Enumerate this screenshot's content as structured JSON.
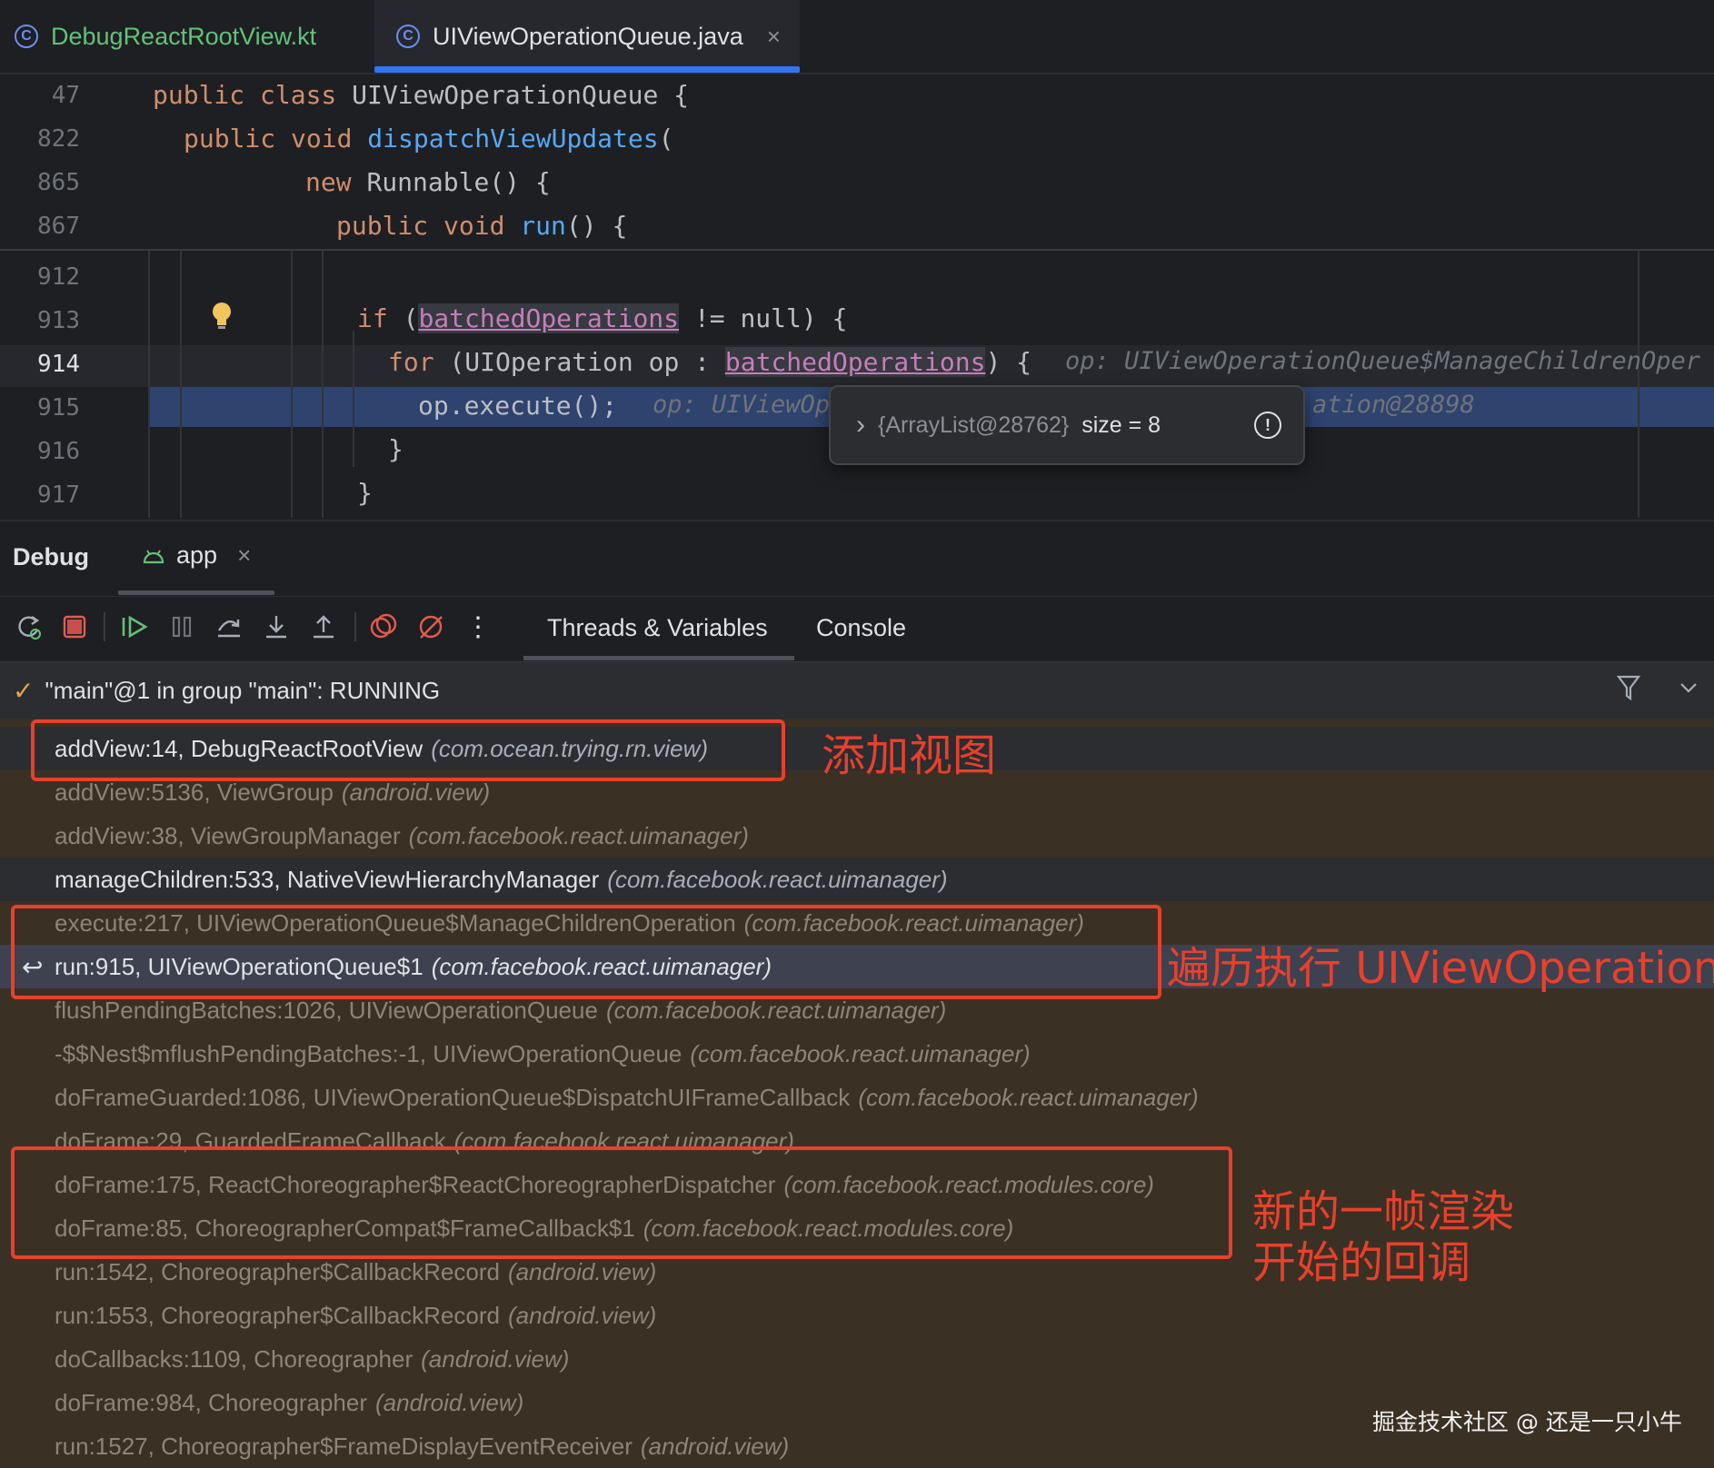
{
  "tabs": [
    {
      "label": "DebugReactRootView.kt"
    },
    {
      "label": "UIViewOperationQueue.java"
    }
  ],
  "tab_close_glyph": "×",
  "code": {
    "sticky": [
      {
        "num": "47",
        "kw": "public class ",
        "rest": "UIViewOperationQueue {"
      },
      {
        "num": "822",
        "kw": "public void ",
        "fn": "dispatchViewUpdates",
        "rest": "("
      },
      {
        "num": "865",
        "kw": "new ",
        "rest": "Runnable() {"
      },
      {
        "num": "867",
        "kw": "public void ",
        "fn": "run",
        "rest": "() {"
      }
    ],
    "lines": [
      {
        "num": "912"
      },
      {
        "num": "913",
        "kw": "if ",
        "p1": "(",
        "fld": "batchedOperations",
        "rest": " != null) {"
      },
      {
        "num": "914",
        "kw": "for ",
        "p1": "(UIOperation op : ",
        "fld": "batchedOperations",
        "rest": ") {",
        "hint": "op: UIViewOperationQueue$ManageChildrenOper"
      },
      {
        "num": "915",
        "text": "op.execute();",
        "hint1": "op: UIViewOp",
        "hint2": "ation@28898"
      },
      {
        "num": "916",
        "text": "}"
      },
      {
        "num": "917",
        "text": "}"
      }
    ],
    "popup": {
      "chevron": "›",
      "ref": "{ArrayList@28762}",
      "value": "size = 8",
      "info": "!"
    }
  },
  "debug": {
    "title": "Debug",
    "session_tab": "app",
    "session_close": "×",
    "tabs": [
      "Threads & Variables",
      "Console"
    ],
    "more": "⋮"
  },
  "thread": {
    "check": "✓",
    "label": "\"main\"@1 in group \"main\": RUNNING",
    "filter": "⊽",
    "expand": "⌄"
  },
  "frames": [
    {
      "text": "addView:14, DebugReactRootView",
      "pkg": "(com.ocean.trying.rn.view)",
      "style": "bright"
    },
    {
      "text": "addView:5136, ViewGroup",
      "pkg": "(android.view)",
      "style": "dim"
    },
    {
      "text": "addView:38, ViewGroupManager",
      "pkg": "(com.facebook.react.uimanager)",
      "style": "dim"
    },
    {
      "text": "manageChildren:533, NativeViewHierarchyManager",
      "pkg": "(com.facebook.react.uimanager)",
      "style": "bright"
    },
    {
      "text": "execute:217, UIViewOperationQueue$ManageChildrenOperation",
      "pkg": "(com.facebook.react.uimanager)",
      "style": "dim"
    },
    {
      "text": "run:915, UIViewOperationQueue$1",
      "pkg": "(com.facebook.react.uimanager)",
      "style": "bright"
    },
    {
      "text": "flushPendingBatches:1026, UIViewOperationQueue",
      "pkg": "(com.facebook.react.uimanager)",
      "style": "dim"
    },
    {
      "text": "-$$Nest$mflushPendingBatches:-1, UIViewOperationQueue",
      "pkg": "(com.facebook.react.uimanager)",
      "style": "dim"
    },
    {
      "text": "doFrameGuarded:1086, UIViewOperationQueue$DispatchUIFrameCallback",
      "pkg": "(com.facebook.react.uimanager)",
      "style": "dim"
    },
    {
      "text": "doFrame:29, GuardedFrameCallback",
      "pkg": "(com.facebook.react.uimanager)",
      "style": "dim"
    },
    {
      "text": "doFrame:175, ReactChoreographer$ReactChoreographerDispatcher",
      "pkg": "(com.facebook.react.modules.core)",
      "style": "dim"
    },
    {
      "text": "doFrame:85, ChoreographerCompat$FrameCallback$1",
      "pkg": "(com.facebook.react.modules.core)",
      "style": "dim"
    },
    {
      "text": "run:1542, Choreographer$CallbackRecord",
      "pkg": "(android.view)",
      "style": "dim"
    },
    {
      "text": "run:1553, Choreographer$CallbackRecord",
      "pkg": "(android.view)",
      "style": "dim"
    },
    {
      "text": "doCallbacks:1109, Choreographer",
      "pkg": "(android.view)",
      "style": "dim"
    },
    {
      "text": "doFrame:984, Choreographer",
      "pkg": "(android.view)",
      "style": "dim"
    },
    {
      "text": "run:1527, Choreographer$FrameDisplayEventReceiver",
      "pkg": "(android.view)",
      "style": "dim"
    }
  ],
  "return_icon": "↩",
  "annotations": {
    "add_view": "添加视图",
    "iterate": "遍历执行 UIViewOperation",
    "frame_line1": "新的一帧渲染",
    "frame_line2": "开始的回调"
  },
  "watermark": "掘金技术社区 @ 还是一只小牛",
  "colors": {
    "annotation_red": "#e8402c",
    "accent_blue": "#3574f0",
    "keyword": "#cf8e6d",
    "function": "#56a8f5",
    "field": "#c77dbb"
  }
}
